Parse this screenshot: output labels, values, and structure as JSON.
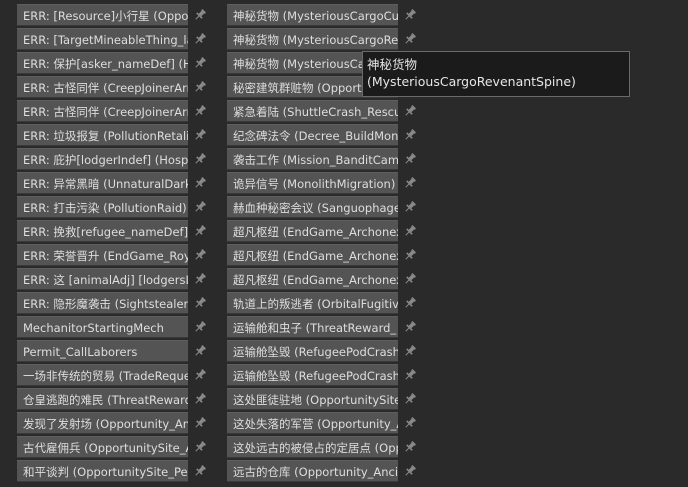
{
  "left_column": {
    "items": [
      {
        "label": "ERR: [Resource]小行星 (OpportunitySite_"
      },
      {
        "label": "ERR: [TargetMineableThing_label"
      },
      {
        "label": "ERR: 保护[asker_nameDef] (Hospitality"
      },
      {
        "label": "ERR: 古怪同伴 (CreepJoinerArrival"
      },
      {
        "label": "ERR: 古怪同伴 (CreepJoinerArrival"
      },
      {
        "label": "ERR: 垃圾报复 (PollutionRetaliation"
      },
      {
        "label": "ERR: 庇护[lodgerIndef] (Hospitality"
      },
      {
        "label": "ERR: 异常黑暗 (UnnaturalDarkness"
      },
      {
        "label": "ERR: 打击污染 (PollutionRaid)"
      },
      {
        "label": "ERR: 挽救[refugee_nameDef] (Hos"
      },
      {
        "label": "ERR: 荣誉晋升 (EndGame_RoyalAscent"
      },
      {
        "label": "ERR: 这 [animalAdj] [lodgersLabel"
      },
      {
        "label": "ERR: 隐形魔袭击 (SightstealerArrival"
      },
      {
        "label": "MechanitorStartingMech"
      },
      {
        "label": "Permit_CallLaborers"
      },
      {
        "label": "一场非传统的贸易 (TradeRequest"
      },
      {
        "label": "仓皇逃跑的难民 (ThreatReward_"
      },
      {
        "label": "发现了发射场 (Opportunity_AncientLaunch"
      },
      {
        "label": "古代雇佣兵 (OpportunitySite_Ancient"
      },
      {
        "label": "和平谈判 (OpportunitySite_PeaceTalks"
      }
    ]
  },
  "right_column": {
    "items": [
      {
        "label": "神秘货物 (MysteriousCargoCube"
      },
      {
        "label": "神秘货物 (MysteriousCargoRevenant"
      },
      {
        "label": "神秘货物 (MysteriousCargo"
      },
      {
        "label": "秘密建筑群赃物 (OpportunitySite"
      },
      {
        "label": "紧急着陆 (ShuttleCrash_Rescue"
      },
      {
        "label": "纪念碑法令 (Decree_BuildMonument"
      },
      {
        "label": "袭击工作 (Mission_BanditCamp"
      },
      {
        "label": "诡异信号 (MonolithMigration)"
      },
      {
        "label": "赫血种秘密会议 (Sanguophage"
      },
      {
        "label": "超凡枢纽 (EndGame_Archonexus"
      },
      {
        "label": "超凡枢纽 (EndGame_Archonexus"
      },
      {
        "label": "超凡枢纽 (EndGame_Archonexus"
      },
      {
        "label": "轨道上的叛逃者 (OrbitalFugitive"
      },
      {
        "label": "运输舱和虫子 (ThreatReward_"
      },
      {
        "label": "运输舱坠毁 (RefugeePodCrash)"
      },
      {
        "label": "运输舱坠毁 (RefugeePodCrash_"
      },
      {
        "label": "这处匪徒驻地 (OpportunitySite_"
      },
      {
        "label": "这处失落的军营 (Opportunity_Ancient"
      },
      {
        "label": "这处远古的被侵占的定居点 (Opp"
      },
      {
        "label": "远古的仓库 (Opportunity_Ancient"
      }
    ]
  },
  "tooltip": {
    "line1": "神秘货物",
    "line2": "(MysteriousCargoRevenantSpine)"
  },
  "icons": {
    "pin": "pin-icon"
  },
  "colors": {
    "background": "#2a2a2a",
    "button": "#545454",
    "text": "#dedede",
    "pin": "#8a8a8a"
  }
}
